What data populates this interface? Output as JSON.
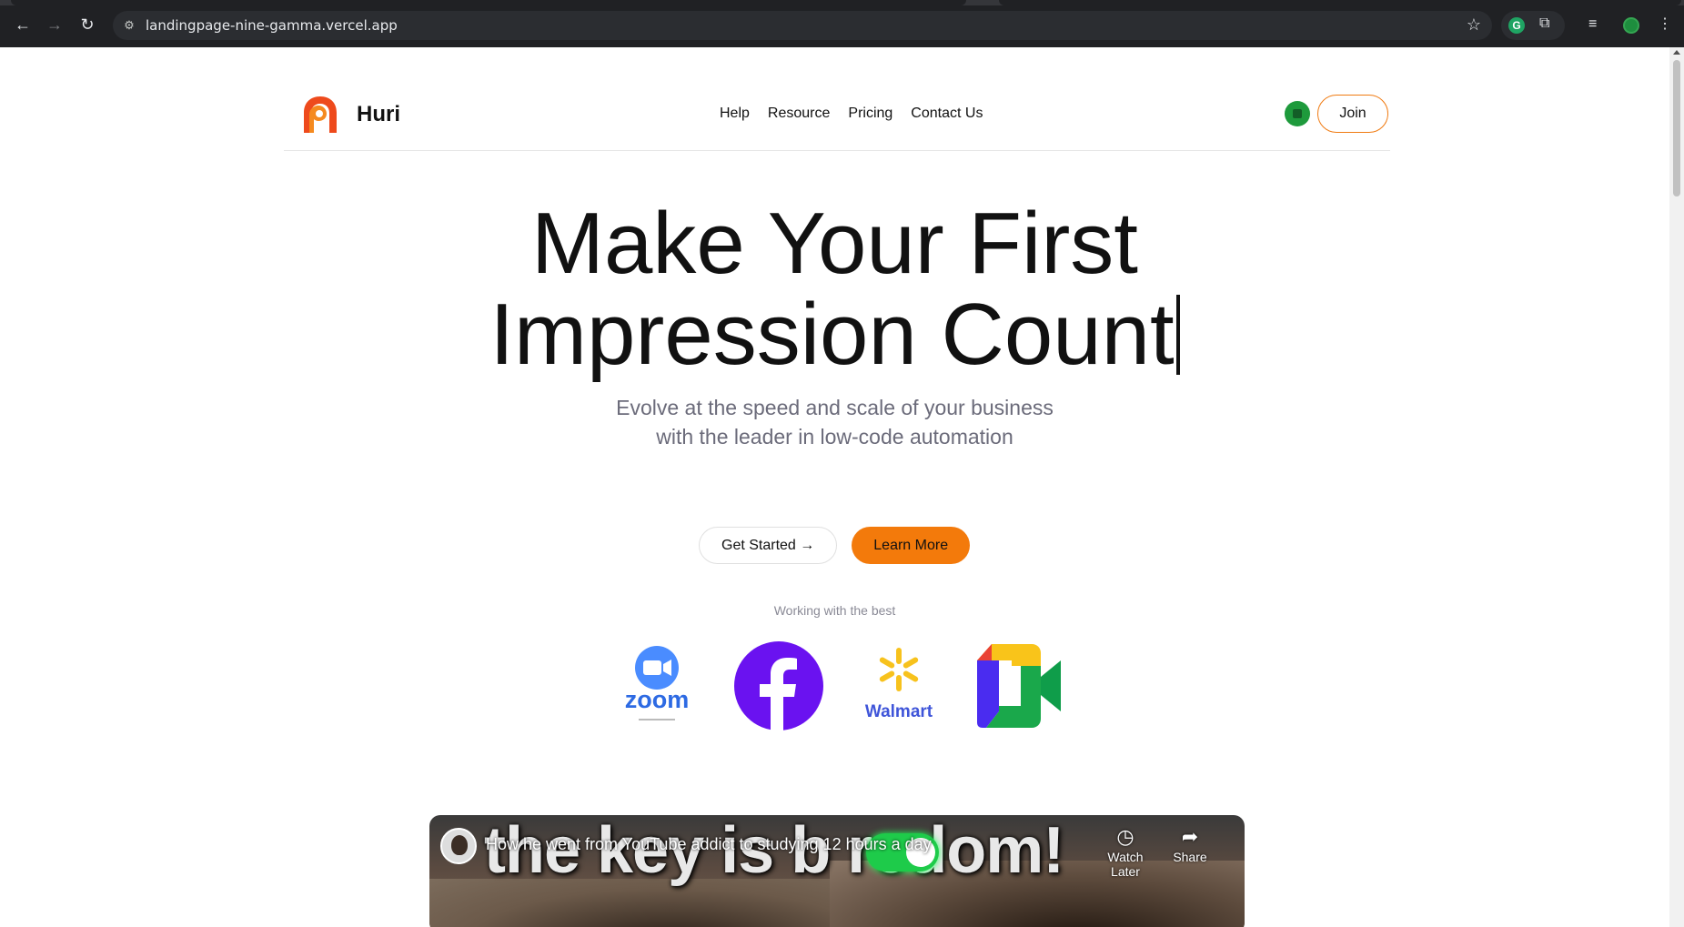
{
  "browser": {
    "url": "landingpage-nine-gamma.vercel.app",
    "back_icon": "←",
    "forward_icon": "→",
    "reload_icon": "↻",
    "star_icon": "☆",
    "grammarly_label": "G",
    "extensions_icon": "⧉",
    "media_icon": "≡",
    "menu_icon": "⋮"
  },
  "nav": {
    "brand": "Huri",
    "links": [
      "Help",
      "Resource",
      "Pricing",
      "Contact Us"
    ],
    "join_label": "Join",
    "accent_color": "#f37a0b"
  },
  "hero": {
    "title_line1": "Make Your First",
    "title_line2": "Impression Count",
    "subtitle_line1": "Evolve at the speed and scale of your business",
    "subtitle_line2": "with the leader in low-code automation"
  },
  "cta": {
    "get_started": "Get Started →",
    "learn_more": "Learn More"
  },
  "partners": {
    "heading": "Working with the best",
    "logos": [
      "zoom",
      "Walmart"
    ]
  },
  "video": {
    "overlay_text": "the key is b   redom!",
    "title": "How he went from YouTube addict to studying 12 hours a day",
    "watch_later": "Watch Later",
    "share": "Share"
  }
}
